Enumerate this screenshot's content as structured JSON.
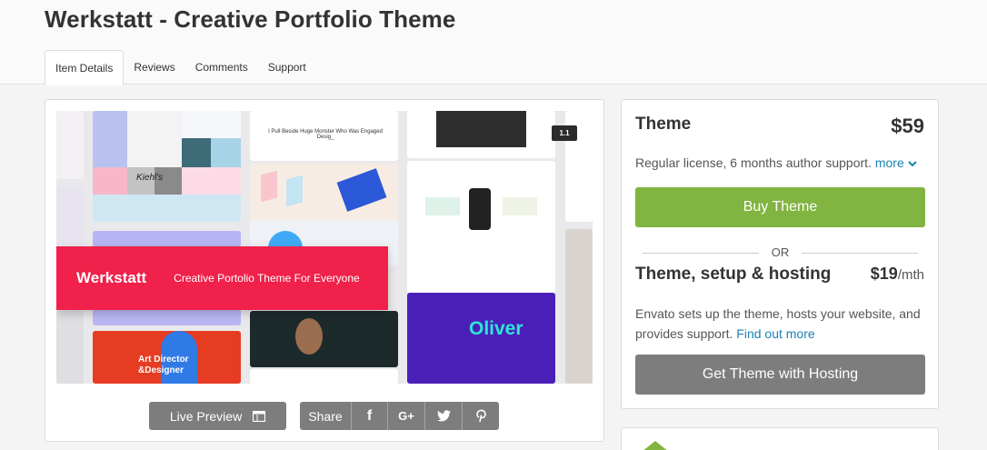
{
  "page": {
    "title": "Werkstatt - Creative Portfolio Theme"
  },
  "tabs": [
    {
      "label": "Item Details",
      "active": true
    },
    {
      "label": "Reviews",
      "active": false
    },
    {
      "label": "Comments",
      "active": false
    },
    {
      "label": "Support",
      "active": false
    }
  ],
  "preview": {
    "banner_brand": "Werkstatt",
    "banner_tagline": "Creative Portolio Theme For Everyone",
    "version_badge": "1.1",
    "oliver_text": "Oliver",
    "art_director_line1": "Art Director",
    "art_director_line2": "&Designer",
    "monster_headline": "I Pull Beside Huge Monster Who Was Engaged Desig_",
    "kiehls": "Kiehl's",
    "live_preview_label": "Live Preview",
    "share_label": "Share",
    "share_icons": [
      "facebook-icon",
      "google-plus-icon",
      "twitter-icon",
      "pinterest-icon"
    ],
    "share_glyphs": [
      "f",
      "G+",
      "🐦",
      "℗"
    ]
  },
  "purchase": {
    "license_title": "Theme",
    "license_price": "$59",
    "license_desc": "Regular license, 6 months author support.",
    "more_label": "more",
    "buy_label": "Buy Theme",
    "or_label": "OR",
    "hosting_title": "Theme, setup & hosting",
    "hosting_price": "$19",
    "hosting_unit": "/mth",
    "hosting_desc": "Envato sets up the theme, hosts your website, and provides support.",
    "find_out_label": "Find out more",
    "hosting_button_label": "Get Theme with Hosting"
  },
  "colors": {
    "accent_green": "#81b441",
    "banner_red": "#f0214a",
    "link_blue": "#1a81b4",
    "button_gray": "#7d7d7d",
    "oliver_purple": "#4a1fb8",
    "oliver_cyan": "#2ee6d6"
  }
}
